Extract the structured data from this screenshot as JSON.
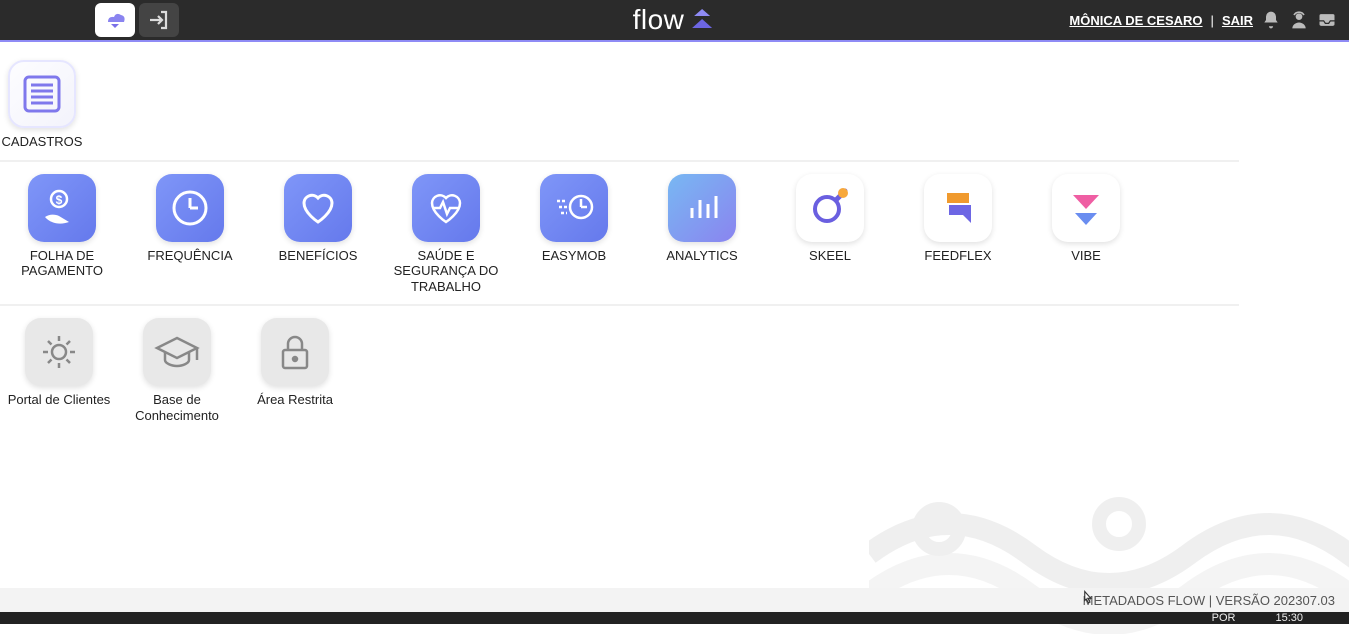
{
  "header": {
    "user_name": "MÔNICA DE CESARO",
    "separator": "|",
    "logout_label": "SAIR",
    "logo_text": "flow"
  },
  "sections": [
    {
      "items": [
        {
          "label": "CADASTROS",
          "icon": "list-icon",
          "tile": "tile-outline",
          "wide": false
        }
      ]
    },
    {
      "items": [
        {
          "label": "FOLHA DE PAGAMENTO",
          "icon": "payroll-icon",
          "tile": "tile-blue",
          "wide": true
        },
        {
          "label": "FREQUÊNCIA",
          "icon": "clock-icon",
          "tile": "tile-blue",
          "wide": true
        },
        {
          "label": "BENEFÍCIOS",
          "icon": "heart-icon",
          "tile": "tile-blue",
          "wide": true
        },
        {
          "label": "SAÚDE E SEGURANÇA DO TRABALHO",
          "icon": "health-icon",
          "tile": "tile-blue",
          "wide": true
        },
        {
          "label": "EASYMOB",
          "icon": "easymob-icon",
          "tile": "tile-blue",
          "wide": true
        },
        {
          "label": "ANALYTICS",
          "icon": "analytics-icon",
          "tile": "tile-gradient",
          "wide": true
        },
        {
          "label": "SKEEL",
          "icon": "skeel-icon",
          "tile": "tile-white",
          "wide": true
        },
        {
          "label": "FEEDFLEX",
          "icon": "feedflex-icon",
          "tile": "tile-white",
          "wide": true
        },
        {
          "label": "VIBE",
          "icon": "vibe-icon",
          "tile": "tile-white",
          "wide": true
        }
      ]
    },
    {
      "items": [
        {
          "label": "Portal de Clientes",
          "icon": "gear-icon",
          "tile": "tile-gray",
          "wide": true
        },
        {
          "label": "Base de Conhecimento",
          "icon": "graduation-icon",
          "tile": "tile-gray",
          "wide": true
        },
        {
          "label": "Área Restrita",
          "icon": "lock-icon",
          "tile": "tile-gray",
          "wide": true
        }
      ]
    }
  ],
  "footer": {
    "version_text": "METADADOS FLOW | VERSÃO 202307.03"
  },
  "taskbar": {
    "lang": "POR",
    "time": "15:30"
  }
}
